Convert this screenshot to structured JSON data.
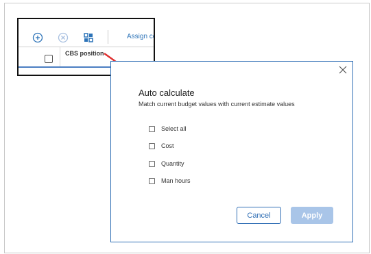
{
  "toolbar": {
    "assign_label": "Assign co",
    "icons": [
      "plus-circle-icon",
      "cancel-circle-icon",
      "grid-icon"
    ]
  },
  "grid": {
    "column_header": "CBS position"
  },
  "dialog": {
    "title": "Auto calculate",
    "subtitle": "Match current budget values with current estimate values",
    "options": [
      {
        "label": "Select all",
        "checked": false
      },
      {
        "label": "Cost",
        "checked": false
      },
      {
        "label": "Quantity",
        "checked": false
      },
      {
        "label": "Man hours",
        "checked": false
      }
    ],
    "cancel_label": "Cancel",
    "apply_label": "Apply"
  },
  "colors": {
    "accent": "#2e6db4",
    "apply_disabled": "#a9c5e8",
    "arrow": "#e03030"
  }
}
